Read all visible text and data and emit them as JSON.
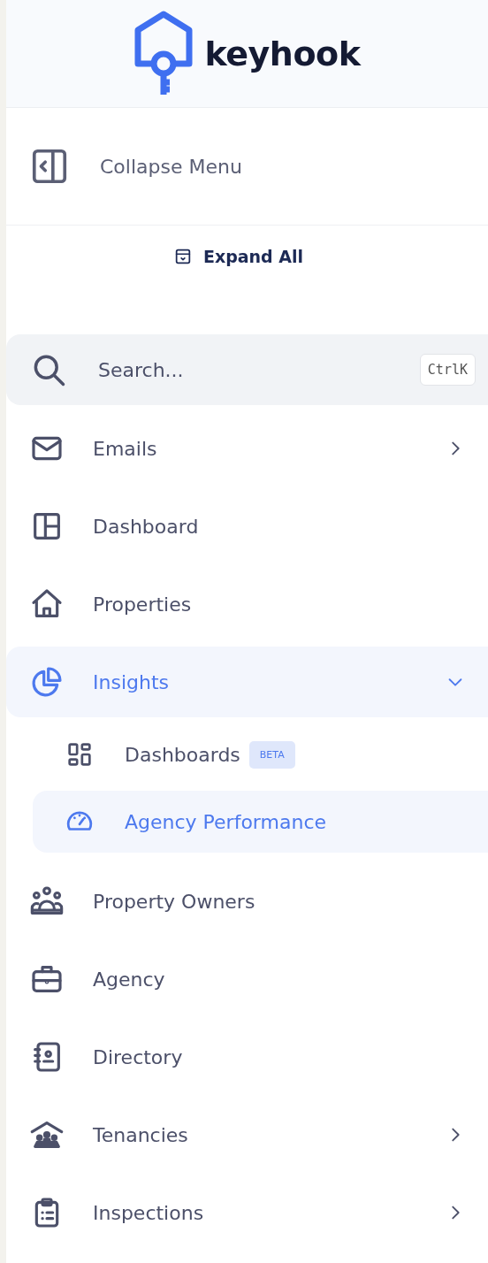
{
  "brand": {
    "name": "keyhook"
  },
  "collapse_button": {
    "label": "Collapse Menu"
  },
  "expand_button": {
    "label": "Expand All"
  },
  "search": {
    "placeholder": "Search...",
    "shortcut": "CtrlK"
  },
  "nav": [
    {
      "label": "Emails",
      "selected": false,
      "expanded": false
    },
    {
      "label": "Dashboard",
      "selected": false
    },
    {
      "label": "Properties",
      "selected": false
    },
    {
      "label": "Insights",
      "selected": true,
      "expanded": true,
      "children": [
        {
          "label": "Dashboards",
          "selected": false,
          "badge": "BETA"
        },
        {
          "label": "Agency Performance",
          "selected": true
        }
      ]
    },
    {
      "label": "Property Owners",
      "selected": false
    },
    {
      "label": "Agency",
      "selected": false
    },
    {
      "label": "Directory",
      "selected": false
    },
    {
      "label": "Tenancies",
      "selected": false,
      "expanded": false
    },
    {
      "label": "Inspections",
      "selected": false,
      "expanded": false
    }
  ]
}
